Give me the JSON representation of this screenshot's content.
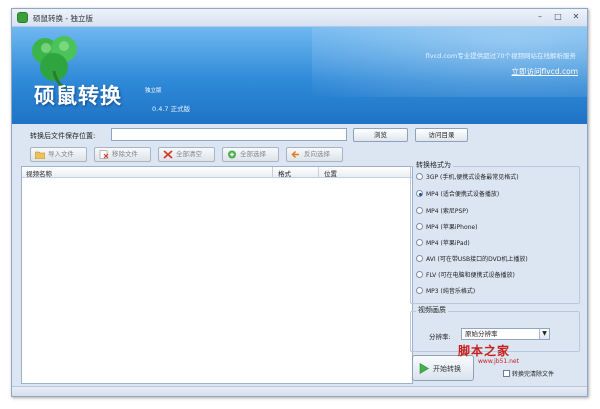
{
  "window": {
    "title": "硕鼠转换 - 独立版",
    "controls": [
      "–",
      "□",
      "✕"
    ]
  },
  "banner": {
    "brand": "硕鼠转换",
    "edition": "独立版",
    "version": "0.4.7 正式版",
    "slogan": "flvcd.com专业提供超过70个视频网站在线解析服务",
    "link": "立即访问flvcd.com"
  },
  "save": {
    "label": "转换后文件保存位置:",
    "value": "",
    "browse_label": "浏览",
    "visit_label": "访问目录"
  },
  "toolbar": {
    "import_label": "导入文件",
    "remove_label": "移除文件",
    "clear_label": "全部清空",
    "select_all_label": "全部选择",
    "invert_label": "反向选择"
  },
  "list": {
    "columns": [
      "视频名称",
      "格式",
      "位置"
    ],
    "rows": []
  },
  "format": {
    "title": "转换格式为",
    "selected": 1,
    "options": [
      "3GP (手机,便携式设备最常见格式)",
      "MP4 (适合便携式设备播放)",
      "MP4 (索尼PSP)",
      "MP4 (苹果iPhone)",
      "MP4 (苹果iPad)",
      "AVI (可在带USB接口的DVD机上播放)",
      "FLV (可在电脑和便携式设备播放)",
      "MP3 (纯音乐格式)"
    ]
  },
  "quality": {
    "title": "视频画质",
    "resolution_label": "分辨率:",
    "resolution_value": "原始分辨率"
  },
  "actions": {
    "convert_label": "开始转换",
    "shutdown_label": "转换完清除文件",
    "shutdown_checked": false
  },
  "watermark": {
    "text": "脚本之家",
    "url": "www.jb51.net"
  },
  "colors": {
    "banner_top": "#6fb8f0",
    "banner_bottom": "#1f73c5",
    "window_bg": "#dce6f3",
    "watermark": "#c8201a"
  }
}
